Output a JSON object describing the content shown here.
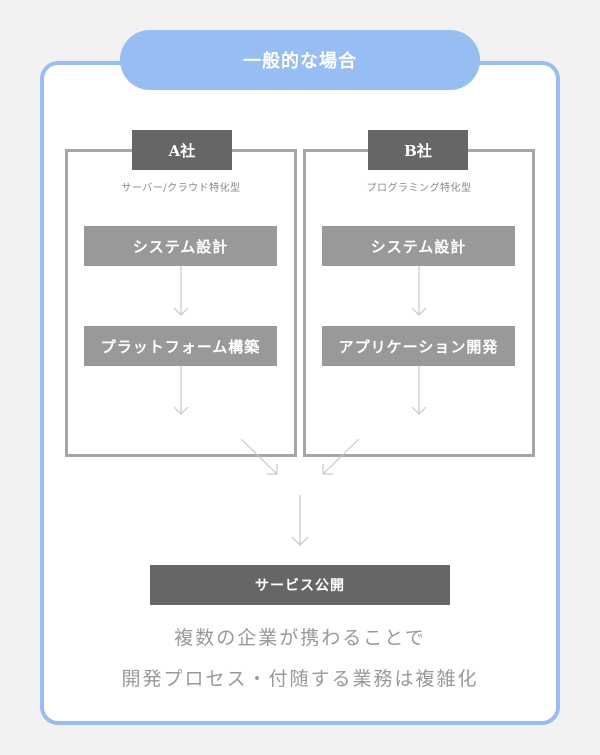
{
  "title": "一般的な場合",
  "companies": [
    {
      "label": "A社",
      "type": "サーバー/クラウド特化型",
      "steps": [
        "システム設計",
        "プラットフォーム構築"
      ]
    },
    {
      "label": "B社",
      "type": "プログラミング特化型",
      "steps": [
        "システム設計",
        "アプリケーション開発"
      ]
    }
  ],
  "result": "サービス公開",
  "notes": [
    "複数の企業が携わることで",
    "開発プロセス・付随する業務は複雑化"
  ],
  "colors": {
    "accent": "#96bef2",
    "dark_label": "#666666",
    "step_fill": "#999999",
    "border": "#a6a6a6",
    "arrow": "#c8c8c8",
    "note_text": "#999999",
    "background": "#f2f2f2"
  }
}
